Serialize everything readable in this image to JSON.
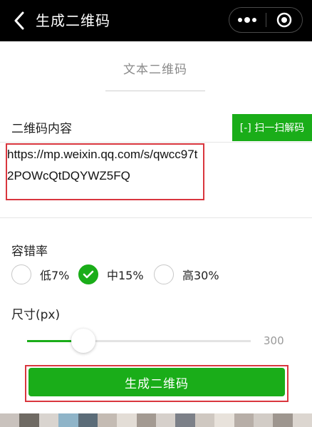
{
  "nav": {
    "title": "生成二维码",
    "back_icon": "chevron-left-icon",
    "more_icon": "more-dots-icon",
    "close_icon": "target-circle-icon"
  },
  "tabs": [
    {
      "label": "文本二维码",
      "active": true
    }
  ],
  "content_section": {
    "label": "二维码内容",
    "scan_button": "[-] 扫一扫解码",
    "url_value": "https://mp.weixin.qq.com/s/qwcc97t2POWcQtDQYWZ5FQ"
  },
  "error_correction": {
    "label": "容错率",
    "options": [
      {
        "label": "低7%",
        "checked": false
      },
      {
        "label": "中15%",
        "checked": true
      },
      {
        "label": "高30%",
        "checked": false
      }
    ]
  },
  "size": {
    "label": "尺寸(px)",
    "value": "300",
    "slider_fraction": 0.25
  },
  "generate_button": "生成二维码",
  "colors": {
    "accent": "#1aad19",
    "highlight_border": "#d9363e",
    "nav_background": "#000000"
  }
}
